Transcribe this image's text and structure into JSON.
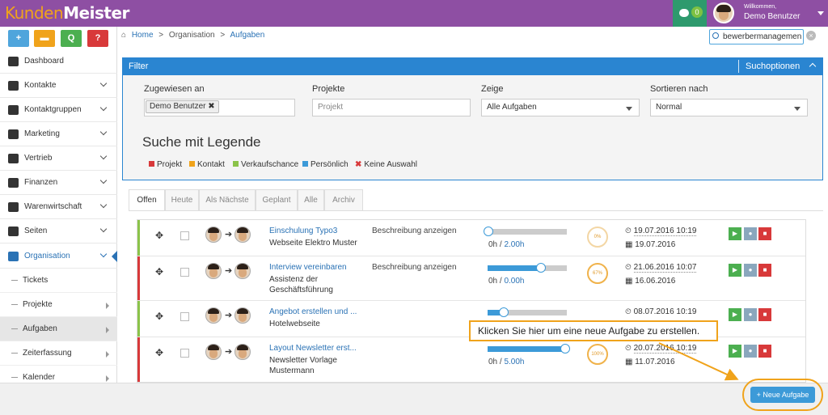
{
  "app": {
    "logo_part1": "Kunden",
    "logo_part2": "Meister",
    "message_count": "0",
    "welcome": "Willkommen,",
    "username": "Demo Benutzer"
  },
  "quick_actions": [
    "+",
    "▬",
    "Q",
    "?"
  ],
  "sidebar": {
    "items": [
      {
        "label": "Dashboard",
        "icon": "dashboard-icon"
      },
      {
        "label": "Kontakte",
        "icon": "user-icon"
      },
      {
        "label": "Kontaktgruppen",
        "icon": "group-icon"
      },
      {
        "label": "Marketing",
        "icon": "envelope-icon"
      },
      {
        "label": "Vertrieb",
        "icon": "bar-chart-icon"
      },
      {
        "label": "Finanzen",
        "icon": "money-icon"
      },
      {
        "label": "Warenwirtschaft",
        "icon": "globe-icon"
      },
      {
        "label": "Seiten",
        "icon": "tree-icon"
      },
      {
        "label": "Organisation",
        "icon": "edit-icon"
      }
    ],
    "sub_items": [
      "Tickets",
      "Projekte",
      "Aufgaben",
      "Zeiterfassung",
      "Kalender"
    ]
  },
  "breadcrumb": {
    "home": "Home",
    "sep": ">",
    "level1": "Organisation",
    "current": "Aufgaben"
  },
  "search": {
    "value": "bewerbermanagemen"
  },
  "filter": {
    "title": "Filter",
    "options_label": "Suchoptionen",
    "assigned_label": "Zugewiesen an",
    "assigned_tag": "Demo Benutzer",
    "projects_label": "Projekte",
    "projects_placeholder": "Projekt",
    "show_label": "Zeige",
    "show_value": "Alle Aufgaben",
    "sort_label": "Sortieren nach",
    "sort_value": "Normal",
    "legend_title": "Suche mit Legende",
    "legend": [
      {
        "label": "Projekt",
        "color": "#d8393a"
      },
      {
        "label": "Kontakt",
        "color": "#f0a31b"
      },
      {
        "label": "Verkaufschance",
        "color": "#8bc34a"
      },
      {
        "label": "Persönlich",
        "color": "#3c9ad8"
      }
    ],
    "no_selection": "Keine Auswahl"
  },
  "tabs": [
    "Offen",
    "Heute",
    "Als Nächste",
    "Geplant",
    "Alle",
    "Archiv"
  ],
  "tasks": [
    {
      "title": "Einschulung Typo3",
      "sub": "Webseite Elektro Muster",
      "desc": "Beschreibung anzeigen",
      "progress": 0,
      "hours_done": "0h /",
      "hours_plan": "2.00h",
      "circle": "0%",
      "date1": "19.07.2016 10:19",
      "date2": "19.07.2016",
      "color": "#8bc34a"
    },
    {
      "title": "Interview vereinbaren",
      "sub": "Assistenz der Geschäftsführung",
      "desc": "Beschreibung anzeigen",
      "progress": 67,
      "hours_done": "0h /",
      "hours_plan": "0.00h",
      "circle": "67%",
      "date1": "21.06.2016 10:07",
      "date2": "16.06.2016",
      "color": "#d8393a"
    },
    {
      "title": "Angebot erstellen und ...",
      "sub": "Hotelwebseite",
      "desc": "",
      "progress": 20,
      "hours_done": "",
      "hours_plan": "",
      "circle": "",
      "date1": "08.07.2016 10:19",
      "date2": "",
      "color": "#8bc34a"
    },
    {
      "title": "Layout Newsletter erst...",
      "sub": "Newsletter Vorlage Mustermann",
      "desc": "",
      "progress": 100,
      "hours_done": "0h /",
      "hours_plan": "5.00h",
      "circle": "100%",
      "date1": "20.07.2016 10:19",
      "date2": "11.07.2016",
      "color": "#d8393a"
    }
  ],
  "tooltip": "Klicken Sie hier um eine neue Aufgabe zu erstellen.",
  "new_task_button": "+ Neue Aufgabe"
}
